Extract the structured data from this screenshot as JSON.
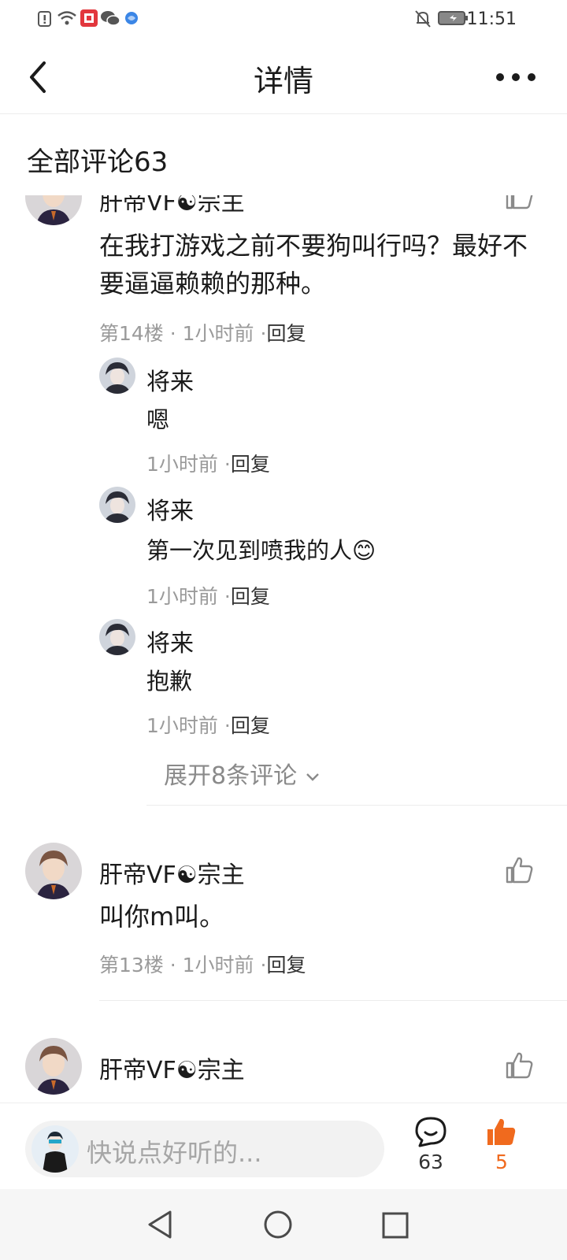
{
  "status_bar": {
    "time": "11:51"
  },
  "header": {
    "title": "详情"
  },
  "section": {
    "title": "全部评论63"
  },
  "comments": [
    {
      "user": "肝帝VF☯宗主",
      "text": "在我打游戏之前不要狗叫行吗？最好不要逼逼赖赖的那种。",
      "floor": "第14楼 · 1小时前 ·",
      "reply_label": "回复",
      "replies": [
        {
          "user": "将来",
          "text": "嗯",
          "time": "1小时前 ·",
          "reply_label": "回复"
        },
        {
          "user": "将来",
          "text": "第一次见到喷我的人😊",
          "time": "1小时前 ·",
          "reply_label": "回复"
        },
        {
          "user": "将来",
          "text": "抱歉",
          "time": "1小时前 ·",
          "reply_label": "回复"
        }
      ],
      "expand_label": "展开8条评论"
    },
    {
      "user": "肝帝VF☯宗主",
      "text": "叫你m叫。",
      "floor": "第13楼 · 1小时前 ·",
      "reply_label": "回复"
    },
    {
      "user": "肝帝VF☯宗主"
    }
  ],
  "bottom_bar": {
    "input_placeholder": "快说点好听的...",
    "comment_count": "63",
    "like_count": "5",
    "accent_color": "#f06a1e"
  },
  "icons": [
    "back-icon",
    "more-icon",
    "like-icon",
    "comment-icon",
    "thumb-up-filled-icon",
    "chevron-down-icon",
    "nav-back-icon",
    "nav-home-icon",
    "nav-recents-icon"
  ]
}
